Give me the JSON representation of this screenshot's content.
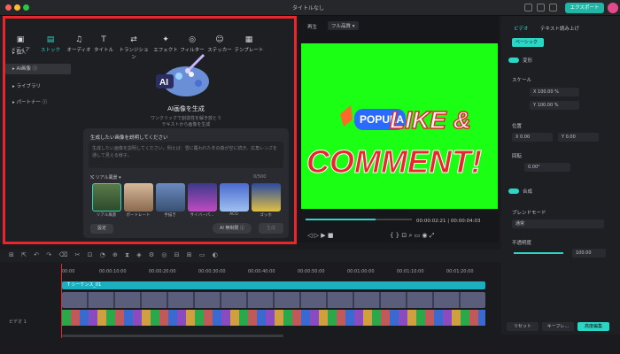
{
  "window": {
    "title": "タイトルなし",
    "export_label": "エクスポート"
  },
  "tabs": [
    {
      "label": "メディア",
      "icon": "media-icon"
    },
    {
      "label": "ストック",
      "icon": "stock-icon"
    },
    {
      "label": "オーディオ",
      "icon": "audio-icon"
    },
    {
      "label": "タイトル",
      "icon": "title-icon"
    },
    {
      "label": "トランジション",
      "icon": "transition-icon"
    },
    {
      "label": "エフェクト",
      "icon": "effect-icon"
    },
    {
      "label": "フィルター",
      "icon": "filter-icon"
    },
    {
      "label": "ステッカー",
      "icon": "sticker-icon"
    },
    {
      "label": "テンプレート",
      "icon": "template-icon"
    }
  ],
  "sidebar": {
    "items": [
      {
        "label": "個人"
      },
      {
        "label": "AI画像"
      },
      {
        "label": "ライブラリ"
      },
      {
        "label": "パートナー"
      }
    ]
  },
  "ai": {
    "title": "AI画像を生成",
    "desc1": "ワンクリックで創造性を解き放とう",
    "desc2": "テキストから画像を生成",
    "prompt_label": "生成したい画像を説明してください",
    "prompt_placeholder": "生成したい画像を説明してください。例えば：雪に覆われた冬の森が空に続き、広角レンズを通して見える様子。",
    "style_selected": "リアル風景",
    "char_count": "0/500",
    "styles": [
      "リアル風景",
      "ポートレート",
      "手描き",
      "サイバーパ...",
      "ACG",
      "ゴッホ"
    ],
    "settings_label": "設定",
    "free_label": "無制限",
    "generate_label": "生成"
  },
  "preview": {
    "label": "再生",
    "quality": "フル品質",
    "timecode": "00:00:02:21 | 00:00:04:03",
    "progress": 0.66,
    "overlay_text1": "LIKE &",
    "overlay_text2": "COMMENT!",
    "popular_text": "POPULA"
  },
  "right_panel": {
    "tab_video": "ビデオ",
    "tab_tts": "テキスト読み上げ",
    "basic": "ベーシック",
    "transform": "変形",
    "scale": "スケール",
    "scale_x": "100.00",
    "scale_y": "100.00",
    "position": "位置",
    "pos_x": "0.00",
    "pos_y": "0.00",
    "rotate": "回転",
    "rotate_val": "0.00°",
    "composite": "合成",
    "blend_label": "ブレンドモード",
    "blend_val": "通常",
    "opacity_label": "不透明度",
    "opacity_val": "100.00",
    "reset": "リセット",
    "keyframe": "キーフレ...",
    "advanced": "高度編集"
  },
  "timeline": {
    "ticks": [
      "00:00",
      "00:00:10:00",
      "00:00:20:00",
      "00:00:30:00",
      "00:00:40:00",
      "00:00:50:00",
      "00:01:00:00",
      "00:01:10:00",
      "00:01:20:00"
    ],
    "sequence_label": "シーケンス_01",
    "track_label": "ビデオ 1"
  },
  "colors": {
    "accent": "#2cd6c4",
    "highlight": "#e8262b",
    "green": "#1bff14"
  }
}
